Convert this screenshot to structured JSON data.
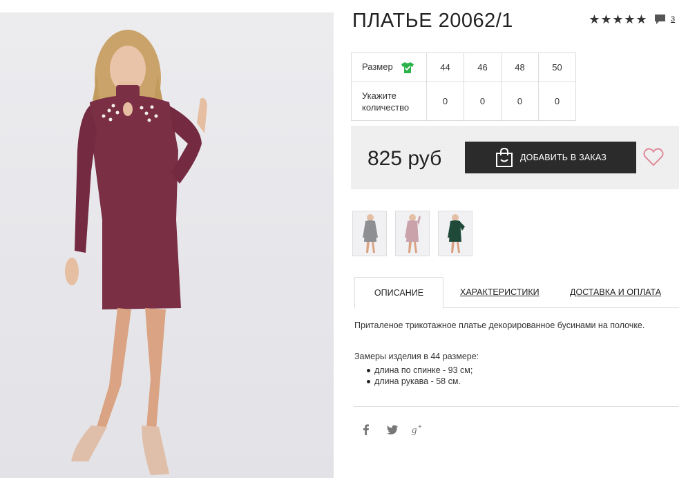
{
  "product": {
    "title": "ПЛАТЬЕ 20062/1",
    "rating_stars": 5,
    "review_count": "3",
    "price": "825 руб"
  },
  "sizes_table": {
    "size_label": "Размер",
    "qty_label": "Укажите количество",
    "sizes": [
      "44",
      "46",
      "48",
      "50"
    ],
    "quantities": [
      "0",
      "0",
      "0",
      "0"
    ]
  },
  "actions": {
    "add_to_order": "ДОБАВИТЬ В ЗАКАЗ"
  },
  "tabs": {
    "description": "ОПИСАНИЕ",
    "characteristics": "ХАРАКТЕРИСТИКИ",
    "delivery": "ДОСТАВКА И ОПЛАТА"
  },
  "description": {
    "intro": "Приталеное трикотажное платье декорированное бусинами на полочке.",
    "measurements_title": "Замеры изделия в 44 размере:",
    "measurements": [
      "длина по спинке - 93 см;",
      "длина рукава - 58 см."
    ]
  },
  "colors": {
    "dress_main": "#7a2f45",
    "thumb_grey": "#8e8f93",
    "thumb_pink": "#c9a2aa",
    "thumb_green": "#1f4a3a",
    "heart": "#e08a9a",
    "shirt_icon": "#2cb24a"
  },
  "icons": {
    "star": "star-icon",
    "comment": "comment-icon",
    "shirt": "shirt-check-icon",
    "bag": "shopping-bag-icon",
    "heart": "heart-icon",
    "social": [
      "facebook-icon",
      "twitter-icon",
      "google-plus-icon"
    ]
  }
}
